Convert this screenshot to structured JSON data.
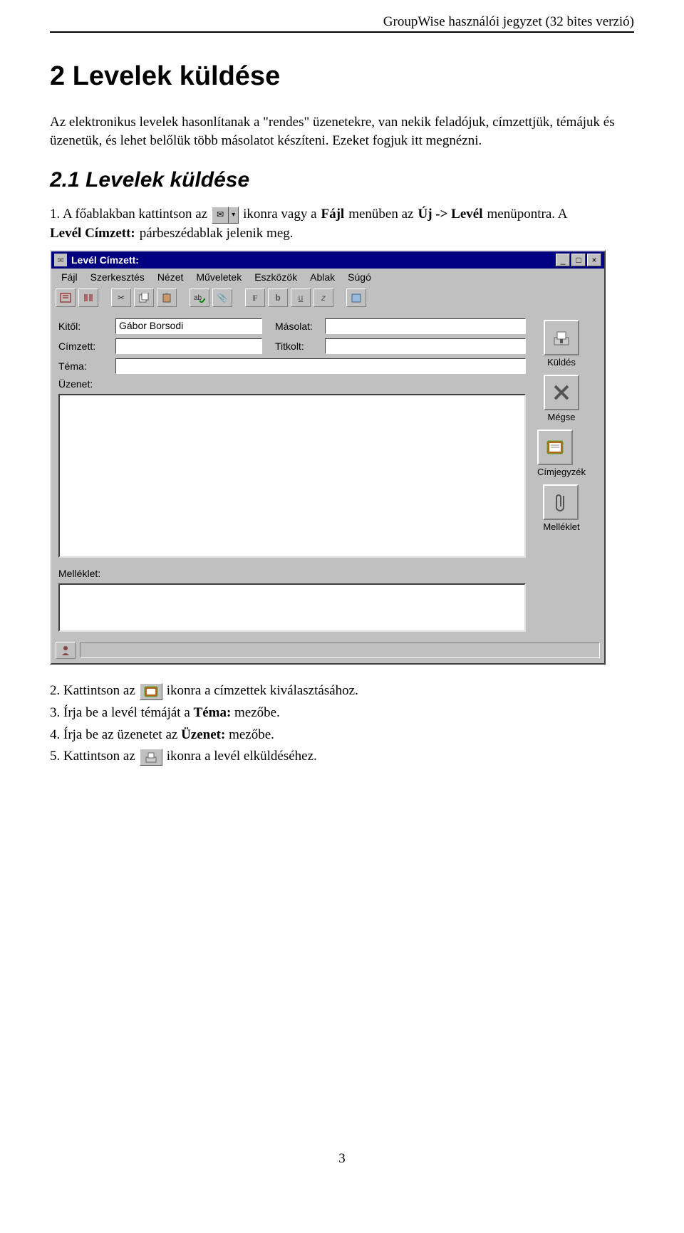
{
  "header": "GroupWise használói jegyzet (32 bites verzió)",
  "chapter_title": "2  Levelek küldése",
  "intro": "Az elektronikus levelek hasonlítanak a \"rendes\" üzenetekre, van nekik feladójuk, címzettjük, témájuk és üzenetük, és lehet belőlük több másolatot készíteni. Ezeket fogjuk itt megnézni.",
  "section_title": "2.1  Levelek küldése",
  "step1": {
    "a": "1. A főablakban kattintson az",
    "b": "ikonra vagy a",
    "bold1": "Fájl",
    "c": "menüben az",
    "bold2": "Új -> Levél",
    "d": "menüpontra. A",
    "line2_bold": "Levél Címzett:",
    "line2_rest": "párbeszédablak jelenik meg."
  },
  "window": {
    "title": "Levél Címzett:",
    "menu": [
      "Fájl",
      "Szerkesztés",
      "Nézet",
      "Műveletek",
      "Eszközök",
      "Ablak",
      "Súgó"
    ],
    "labels": {
      "from": "Kitől:",
      "to": "Címzett:",
      "cc": "Másolat:",
      "bcc": "Titkolt:",
      "subject": "Téma:",
      "message": "Üzenet:",
      "attach": "Melléklet:"
    },
    "from_value": "Gábor Borsodi",
    "buttons": {
      "send": "Küldés",
      "cancel": "Mégse",
      "addrbook": "Címjegyzék",
      "attach": "Melléklet"
    },
    "icons": {
      "send": "send-icon",
      "cancel": "cancel-icon",
      "addrbook": "address-book-icon",
      "attach": "paperclip-icon"
    }
  },
  "step2": {
    "a": "2. Kattintson az",
    "b": "ikonra a címzettek kiválasztásához."
  },
  "step3": {
    "a": "3. Írja be a levél témáját a ",
    "bold": "Téma:",
    "b": " mezőbe."
  },
  "step4": {
    "a": "4. Írja be az üzenetet az ",
    "bold": "Üzenet:",
    "b": " mezőbe."
  },
  "step5": {
    "a": "5. Kattintson az",
    "b": "ikonra a levél elküldéséhez."
  },
  "pagenum": "3"
}
